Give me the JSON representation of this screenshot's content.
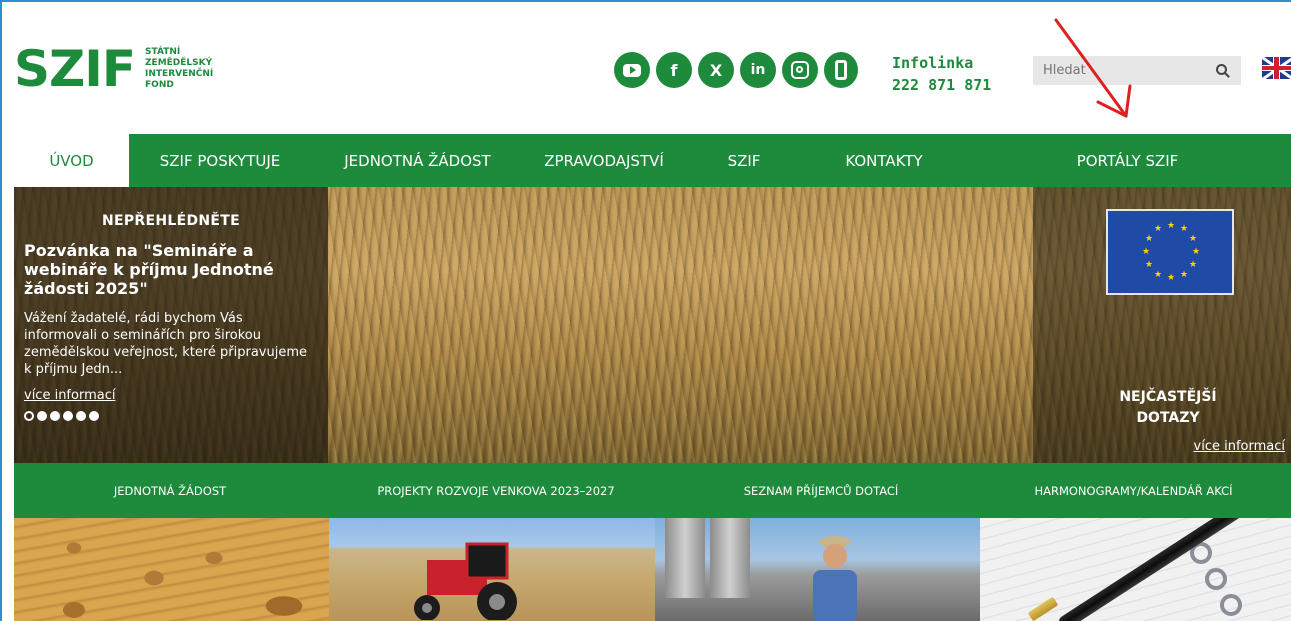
{
  "logo": {
    "mark": "SZIF",
    "lines": [
      "STÁTNÍ",
      "ZEMĚDĚLSKÝ",
      "INTERVENČNÍ",
      "FOND"
    ]
  },
  "header": {
    "socials": [
      "youtube-icon",
      "facebook-icon",
      "x-icon",
      "linkedin-icon",
      "instagram-icon",
      "phone-icon"
    ],
    "infolinka_label": "Infolinka",
    "infolinka_number": "222 871 871",
    "search_placeholder": "Hledat",
    "language": "english-flag-icon"
  },
  "nav": {
    "items": [
      {
        "label": "ÚVOD",
        "active": true
      },
      {
        "label": "SZIF POSKYTUJE",
        "active": false
      },
      {
        "label": "JEDNOTNÁ ŽÁDOST",
        "active": false
      },
      {
        "label": "ZPRAVODAJSTVÍ",
        "active": false
      },
      {
        "label": "SZIF",
        "active": false
      },
      {
        "label": "KONTAKTY",
        "active": false
      },
      {
        "label": "PORTÁLY SZIF",
        "active": false
      }
    ]
  },
  "hero": {
    "tag": "NEPŘEHLÉDNĚTE",
    "title": "Pozvánka na \"Semináře a webináře k příjmu Jednotné žádosti 2025\"",
    "text": "Vážení žadatelé, rádi bychom Vás informovali o seminářích pro širokou zemědělskou veřejnost, které připravujeme k příjmu Jedn...",
    "link": "více informací",
    "slides_total": 6,
    "slides_active": 1,
    "faq_title": "NEJČASTĚJŠÍ DOTAZY",
    "faq_link": "více informací"
  },
  "subnav": {
    "items": [
      "JEDNOTNÁ ŽÁDOST",
      "PROJEKTY ROZVOJE VENKOVA 2023–2027",
      "SEZNAM PŘÍJEMCŮ DOTACÍ",
      "HARMONOGRAMY/KALENDÁŘ AKCÍ"
    ]
  },
  "colors": {
    "brand_green": "#1d8a3c",
    "annotation_red": "#e02020"
  }
}
